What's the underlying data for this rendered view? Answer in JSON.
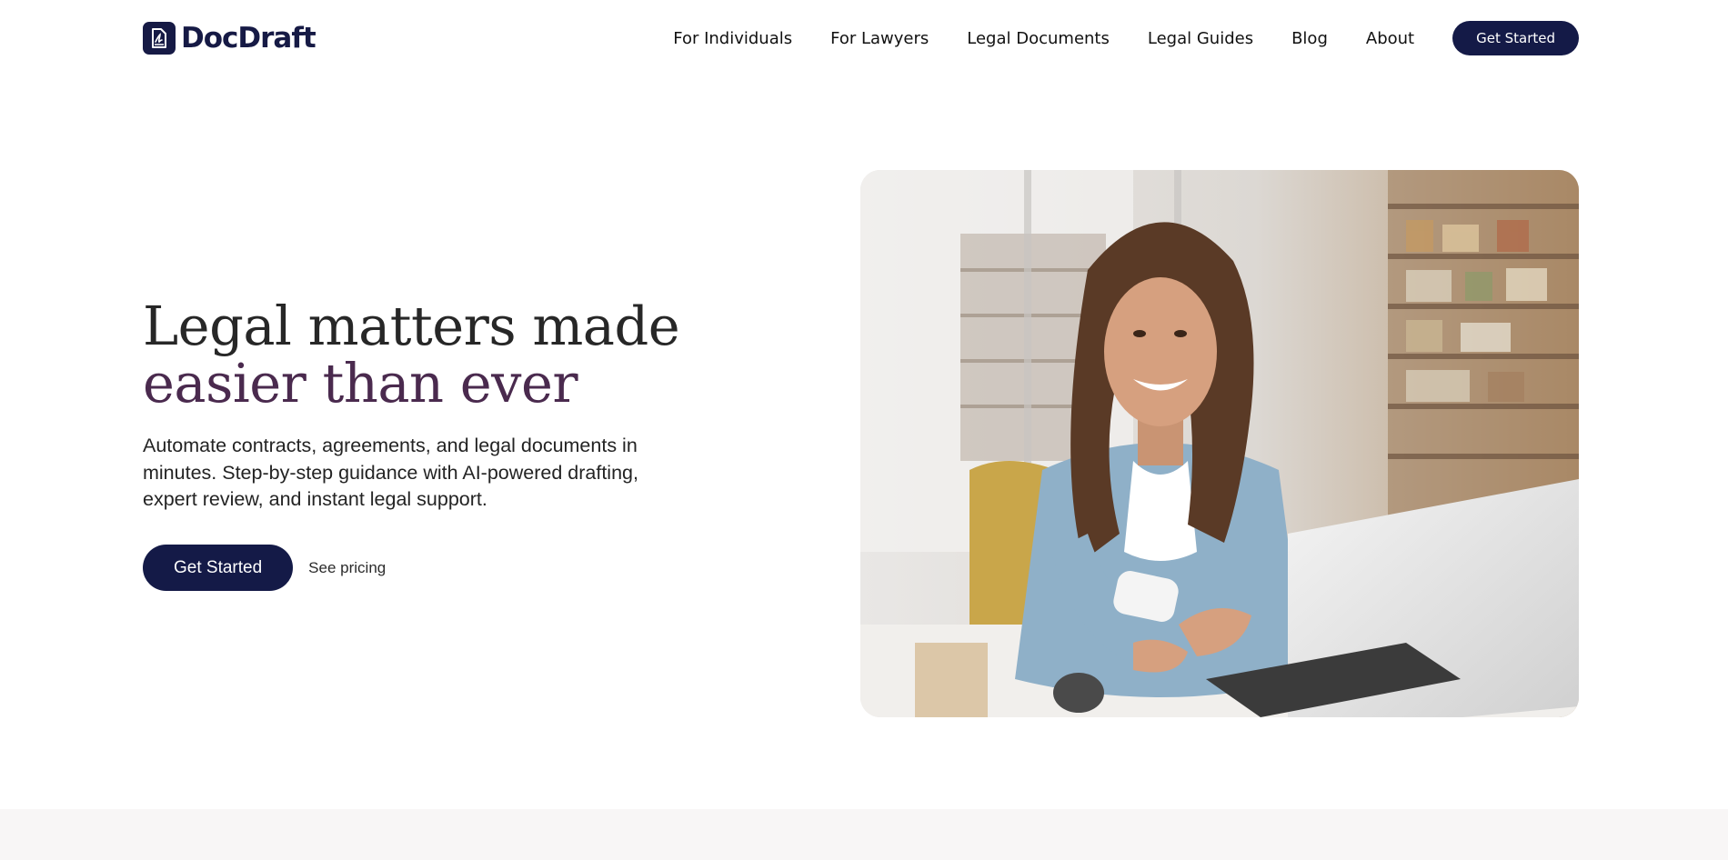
{
  "brand": {
    "name": "DocDraft",
    "primary_color": "#141a47",
    "accent_color": "#4a2a4e",
    "logo_icon": "document-signature-icon"
  },
  "nav": {
    "items": [
      {
        "label": "For Individuals"
      },
      {
        "label": "For Lawyers"
      },
      {
        "label": "Legal Documents"
      },
      {
        "label": "Legal Guides"
      },
      {
        "label": "Blog"
      },
      {
        "label": "About"
      }
    ],
    "cta_label": "Get Started"
  },
  "hero": {
    "title_line1": "Legal matters made",
    "title_line2": "easier than ever",
    "subtitle": "Automate contracts, agreements, and legal documents in minutes. Step-by-step guidance with AI-powered drafting, expert review, and instant legal support.",
    "primary_button": "Get Started",
    "secondary_link": "See pricing",
    "image": "smiling woman holding a phone at a laptop in a workshop"
  }
}
